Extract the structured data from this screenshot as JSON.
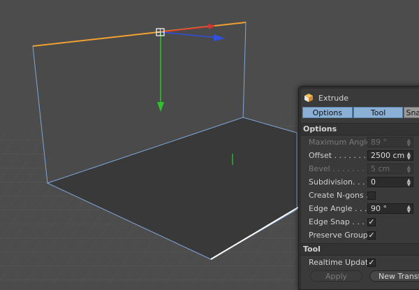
{
  "panel": {
    "title": "Extrude",
    "title_icon": "cube-icon",
    "tabs": [
      {
        "label": "Options",
        "active": true
      },
      {
        "label": "Tool",
        "active": true
      },
      {
        "label": "Snap",
        "active": false
      }
    ],
    "sections": {
      "options": "Options",
      "tool": "Tool"
    },
    "options_rows": [
      {
        "label": "Maximum Angle",
        "value": "89 °",
        "enabled": false
      },
      {
        "label": "Offset . . . . . . .",
        "value": "2500 cm",
        "enabled": true
      },
      {
        "label": "Bevel . . . . . . . .",
        "value": "5 cm",
        "enabled": false
      },
      {
        "label": "Subdivision. . . .",
        "value": "0",
        "enabled": true
      },
      {
        "label": "Create N-gons .",
        "checked": false
      },
      {
        "label": "Edge Angle  . . .",
        "value": "90 °",
        "enabled": true
      },
      {
        "label": "Edge Snap . . . .",
        "checked": true
      },
      {
        "label": "Preserve Groups",
        "checked": true
      }
    ],
    "tool_rows": [
      {
        "label": "Realtime Update",
        "checked": true
      }
    ],
    "buttons": {
      "apply": "Apply",
      "new_transform": "New Transfo"
    },
    "checkmark": "✓"
  },
  "colors": {
    "selected_edge": "#f0a030",
    "polygon_edge": "#7fa8d8",
    "axis_x": "#e03030",
    "axis_y": "#30c030",
    "axis_z": "#3050e0",
    "tab_active": "#8ab0d6"
  }
}
